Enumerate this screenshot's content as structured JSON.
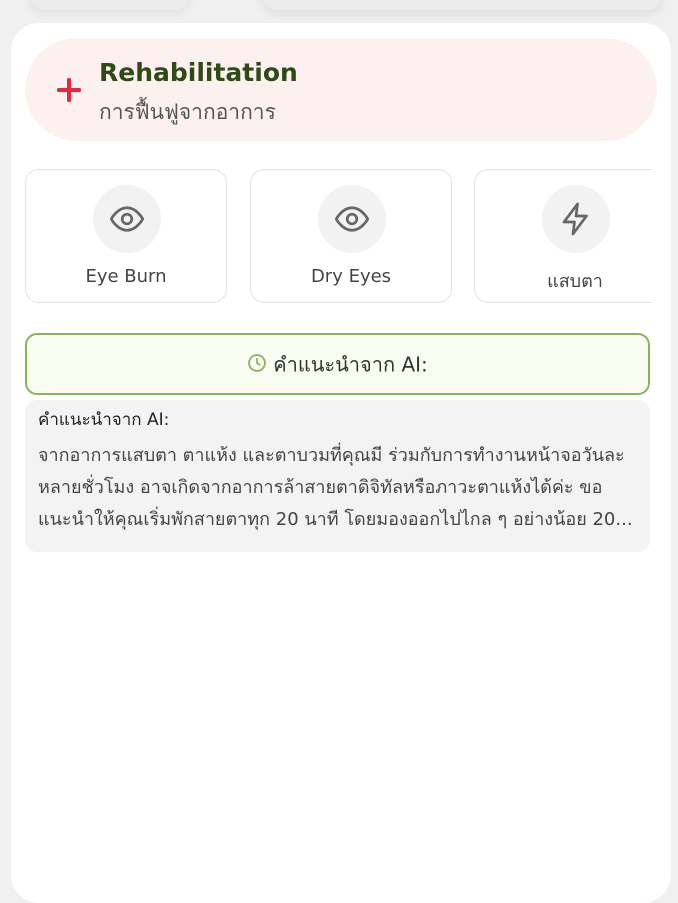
{
  "header": {
    "icon": "plus-icon",
    "title": "Rehabilitation",
    "subtitle": "การฟื้นฟูจากอาการ",
    "accent_color": "#e8283c",
    "title_color": "#2f4a17",
    "background_color": "#fdf1ef"
  },
  "symptoms": [
    {
      "label": "Eye Burn",
      "icon": "eye-icon"
    },
    {
      "label": "Dry Eyes",
      "icon": "eye-icon"
    },
    {
      "label": "แสบตา",
      "icon": "lightning-icon"
    }
  ],
  "ai_button": {
    "icon": "clock-icon",
    "label": "คำแนะนำจาก AI:",
    "border_color": "#8ab45c"
  },
  "ai_panel": {
    "title": "คำแนะนำจาก AI:",
    "body": "จากอาการแสบตา ตาแห้ง และตาบวมที่คุณมี ร่วมกับการทำงานหน้าจอวันละหลายชั่วโมง อาจเกิดจากอาการล้าสายตาดิจิทัลหรือภาวะตาแห้งได้ค่ะ ขอแนะนำให้คุณเริ่มพักสายตาทุก 20 นาที โดยมองออกไปไกล ๆ อย่างน้อย 20..."
  }
}
